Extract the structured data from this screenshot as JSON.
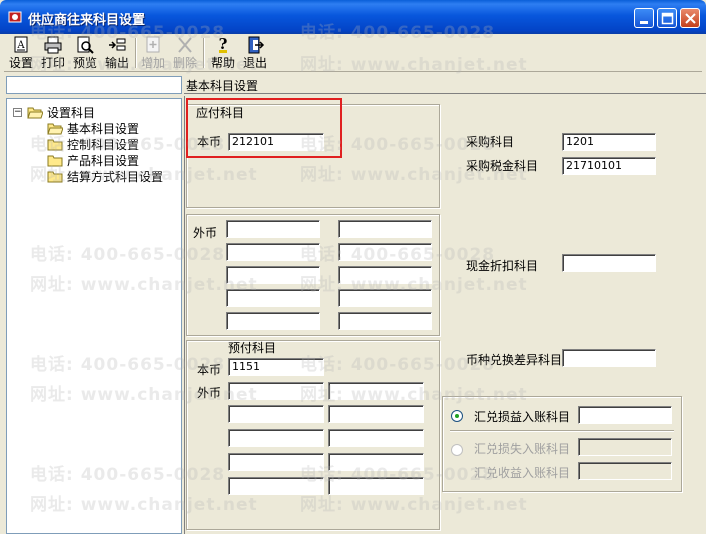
{
  "window": {
    "title": "供应商往来科目设置",
    "title_color": "#0a5fd8"
  },
  "toolbar": {
    "items": [
      {
        "label": "设置",
        "icon": "settings-icon",
        "enabled": true
      },
      {
        "label": "打印",
        "icon": "printer-icon",
        "enabled": true
      },
      {
        "label": "预览",
        "icon": "preview-icon",
        "enabled": true
      },
      {
        "label": "输出",
        "icon": "export-icon",
        "enabled": true
      },
      {
        "label": "增加",
        "icon": "add-icon",
        "enabled": false
      },
      {
        "label": "删除",
        "icon": "delete-icon",
        "enabled": false
      },
      {
        "label": "帮助",
        "icon": "help-icon",
        "enabled": true
      },
      {
        "label": "退出",
        "icon": "exit-icon",
        "enabled": true
      }
    ]
  },
  "tree": {
    "root": "设置科目",
    "children": [
      "基本科目设置",
      "控制科目设置",
      "产品科目设置",
      "结算方式科目设置"
    ],
    "selected": "基本科目设置"
  },
  "panel": {
    "caption": "基本科目设置",
    "payable": {
      "title": "应付科目",
      "base_label": "本币",
      "base_value": "212101",
      "foreign_label": "外币"
    },
    "prepaid": {
      "title": "预付科目",
      "base_label": "本币",
      "base_value": "1151",
      "foreign_label": "外币"
    },
    "purchase_label": "采购科目",
    "purchase_value": "1201",
    "purchase_tax_label": "采购税金科目",
    "purchase_tax_value": "21710101",
    "cash_discount_label": "现金折扣科目",
    "cash_discount_value": "",
    "fx_diff_label": "币种兑换差异科目",
    "fx_diff_value": "",
    "options": [
      {
        "label": "汇兑损益入账科目",
        "selected": true,
        "enabled": true,
        "value": ""
      },
      {
        "label": "汇兑损失入账科目",
        "selected": false,
        "enabled": false,
        "value": ""
      },
      {
        "label": "汇兑收益入账科目",
        "selected": false,
        "enabled": false,
        "value": ""
      }
    ]
  },
  "watermark": {
    "phone": "电话: 400-665-0028",
    "site": "网址: www.chanjet.net"
  }
}
